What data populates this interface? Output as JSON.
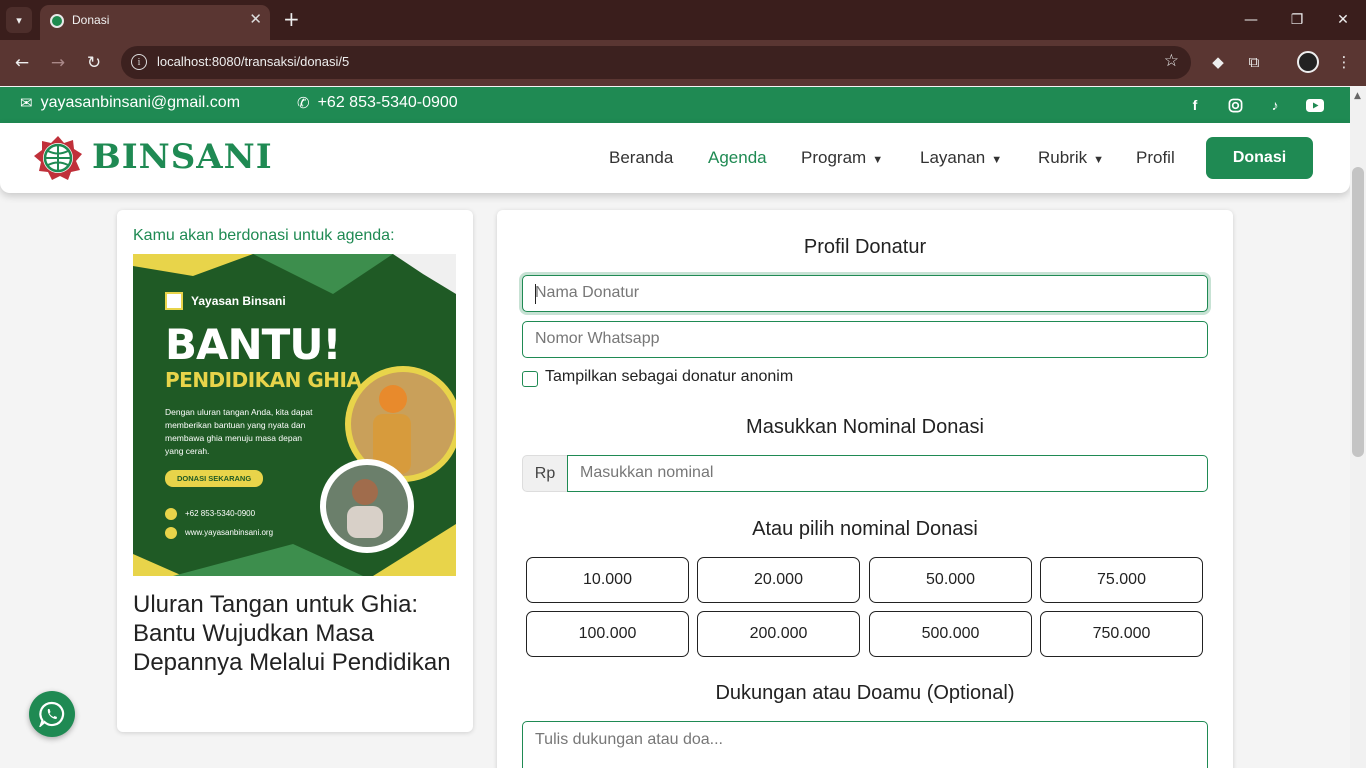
{
  "browser": {
    "tab_title": "Donasi",
    "tab_close": "✕",
    "new_tab": "+",
    "url": "localhost:8080/transaksi/donasi/5",
    "icons": [
      "tab-search-icon",
      "back-icon",
      "forward-icon",
      "reload-icon",
      "info-icon",
      "star-icon",
      "extension-icon",
      "puzzle-icon",
      "profile-icon",
      "menu-icon",
      "minimize-icon",
      "restore-icon",
      "close-icon"
    ]
  },
  "topbar": {
    "email": "yayasanbinsani@gmail.com",
    "phone": "+62 853-5340-0900",
    "social": [
      "facebook-icon",
      "instagram-icon",
      "tiktok-icon",
      "youtube-icon"
    ]
  },
  "navbar": {
    "brand": "BINSANI",
    "links": [
      {
        "label": "Beranda"
      },
      {
        "label": "Agenda"
      },
      {
        "label": "Program"
      },
      {
        "label": "Layanan"
      },
      {
        "label": "Rubrik"
      },
      {
        "label": "Profil"
      }
    ],
    "cta": "Donasi"
  },
  "agenda": {
    "label": "Kamu akan berdonasi untuk agenda:",
    "title": "Uluran Tangan untuk Ghia: Bantu Wujudkan Masa Depannya Melalui Pendidikan",
    "poster": {
      "org": "Yayasan Binsani",
      "headline": "BANTU!",
      "subheadline": "PENDIDIKAN GHIA",
      "body": "Dengan uluran tangan Anda, kita dapat memberikan bantuan yang nyata dan membawa ghia menuju masa depan yang cerah.",
      "button": "DONASI SEKARANG",
      "phone": "+62 853-5340-0900",
      "website": "www.yayasanbinsani.org"
    }
  },
  "form": {
    "profile_title": "Profil Donatur",
    "name_placeholder": "Nama Donatur",
    "wa_placeholder": "Nomor Whatsapp",
    "anon_label": "Tampilkan sebagai donatur anonim",
    "nominal_title": "Masukkan Nominal Donasi",
    "currency": "Rp",
    "nominal_placeholder": "Masukkan nominal",
    "choose_title": "Atau pilih nominal Donasi",
    "amounts": [
      "10.000",
      "20.000",
      "50.000",
      "75.000",
      "100.000",
      "200.000",
      "500.000",
      "750.000"
    ],
    "support_title": "Dukungan atau Doamu (Optional)",
    "support_placeholder": "Tulis dukungan atau doa..."
  },
  "colors": {
    "brand": "#1f8a53",
    "chrome": "#3a1e1c"
  }
}
